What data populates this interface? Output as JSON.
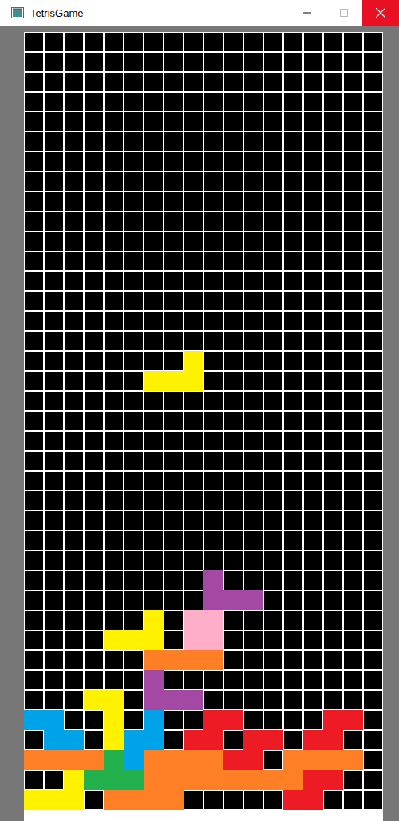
{
  "window": {
    "title": "TetrisGame"
  },
  "board": {
    "columns": 18,
    "rows": 39,
    "blocks": [
      {
        "row": 27,
        "col": 9,
        "color": "#a349a4"
      },
      {
        "row": 28,
        "col": 9,
        "color": "#a349a4"
      },
      {
        "row": 28,
        "col": 10,
        "color": "#a349a4"
      },
      {
        "row": 28,
        "col": 11,
        "color": "#a349a4"
      },
      {
        "row": 29,
        "col": 6,
        "color": "#fff200"
      },
      {
        "row": 29,
        "col": 8,
        "color": "#ffaec9"
      },
      {
        "row": 29,
        "col": 9,
        "color": "#ffaec9"
      },
      {
        "row": 30,
        "col": 4,
        "color": "#fff200"
      },
      {
        "row": 30,
        "col": 5,
        "color": "#fff200"
      },
      {
        "row": 30,
        "col": 6,
        "color": "#fff200"
      },
      {
        "row": 30,
        "col": 8,
        "color": "#ffaec9"
      },
      {
        "row": 30,
        "col": 9,
        "color": "#ffaec9"
      },
      {
        "row": 31,
        "col": 6,
        "color": "#ff7f27"
      },
      {
        "row": 31,
        "col": 7,
        "color": "#ff7f27"
      },
      {
        "row": 31,
        "col": 8,
        "color": "#ff7f27"
      },
      {
        "row": 31,
        "col": 9,
        "color": "#ff7f27"
      },
      {
        "row": 32,
        "col": 6,
        "color": "#a349a4"
      },
      {
        "row": 33,
        "col": 3,
        "color": "#fff200"
      },
      {
        "row": 33,
        "col": 4,
        "color": "#fff200"
      },
      {
        "row": 33,
        "col": 6,
        "color": "#a349a4"
      },
      {
        "row": 33,
        "col": 7,
        "color": "#a349a4"
      },
      {
        "row": 33,
        "col": 8,
        "color": "#a349a4"
      },
      {
        "row": 34,
        "col": 0,
        "color": "#00a2e8"
      },
      {
        "row": 34,
        "col": 1,
        "color": "#00a2e8"
      },
      {
        "row": 34,
        "col": 4,
        "color": "#fff200"
      },
      {
        "row": 34,
        "col": 6,
        "color": "#00a2e8"
      },
      {
        "row": 34,
        "col": 9,
        "color": "#ed1c24"
      },
      {
        "row": 34,
        "col": 10,
        "color": "#ed1c24"
      },
      {
        "row": 34,
        "col": 15,
        "color": "#ed1c24"
      },
      {
        "row": 34,
        "col": 16,
        "color": "#ed1c24"
      },
      {
        "row": 35,
        "col": 1,
        "color": "#00a2e8"
      },
      {
        "row": 35,
        "col": 2,
        "color": "#00a2e8"
      },
      {
        "row": 35,
        "col": 4,
        "color": "#fff200"
      },
      {
        "row": 35,
        "col": 5,
        "color": "#00a2e8"
      },
      {
        "row": 35,
        "col": 6,
        "color": "#00a2e8"
      },
      {
        "row": 35,
        "col": 8,
        "color": "#ed1c24"
      },
      {
        "row": 35,
        "col": 9,
        "color": "#ed1c24"
      },
      {
        "row": 35,
        "col": 11,
        "color": "#ed1c24"
      },
      {
        "row": 35,
        "col": 12,
        "color": "#ed1c24"
      },
      {
        "row": 35,
        "col": 14,
        "color": "#ed1c24"
      },
      {
        "row": 35,
        "col": 15,
        "color": "#ed1c24"
      },
      {
        "row": 36,
        "col": 0,
        "color": "#ff7f27"
      },
      {
        "row": 36,
        "col": 1,
        "color": "#ff7f27"
      },
      {
        "row": 36,
        "col": 2,
        "color": "#ff7f27"
      },
      {
        "row": 36,
        "col": 3,
        "color": "#ff7f27"
      },
      {
        "row": 36,
        "col": 4,
        "color": "#22b14c"
      },
      {
        "row": 36,
        "col": 5,
        "color": "#00a2e8"
      },
      {
        "row": 36,
        "col": 6,
        "color": "#ff7f27"
      },
      {
        "row": 36,
        "col": 7,
        "color": "#ff7f27"
      },
      {
        "row": 36,
        "col": 8,
        "color": "#ff7f27"
      },
      {
        "row": 36,
        "col": 9,
        "color": "#ff7f27"
      },
      {
        "row": 36,
        "col": 10,
        "color": "#ed1c24"
      },
      {
        "row": 36,
        "col": 11,
        "color": "#ed1c24"
      },
      {
        "row": 36,
        "col": 13,
        "color": "#ff7f27"
      },
      {
        "row": 36,
        "col": 14,
        "color": "#ff7f27"
      },
      {
        "row": 36,
        "col": 15,
        "color": "#ff7f27"
      },
      {
        "row": 36,
        "col": 16,
        "color": "#ff7f27"
      },
      {
        "row": 37,
        "col": 2,
        "color": "#fff200"
      },
      {
        "row": 37,
        "col": 3,
        "color": "#22b14c"
      },
      {
        "row": 37,
        "col": 4,
        "color": "#22b14c"
      },
      {
        "row": 37,
        "col": 5,
        "color": "#22b14c"
      },
      {
        "row": 37,
        "col": 6,
        "color": "#ff7f27"
      },
      {
        "row": 37,
        "col": 7,
        "color": "#ff7f27"
      },
      {
        "row": 37,
        "col": 8,
        "color": "#ff7f27"
      },
      {
        "row": 37,
        "col": 9,
        "color": "#ff7f27"
      },
      {
        "row": 37,
        "col": 10,
        "color": "#ff7f27"
      },
      {
        "row": 37,
        "col": 11,
        "color": "#ff7f27"
      },
      {
        "row": 37,
        "col": 12,
        "color": "#ff7f27"
      },
      {
        "row": 37,
        "col": 13,
        "color": "#ff7f27"
      },
      {
        "row": 37,
        "col": 14,
        "color": "#ed1c24"
      },
      {
        "row": 37,
        "col": 15,
        "color": "#ed1c24"
      },
      {
        "row": 38,
        "col": 0,
        "color": "#fff200"
      },
      {
        "row": 38,
        "col": 1,
        "color": "#fff200"
      },
      {
        "row": 38,
        "col": 2,
        "color": "#fff200"
      },
      {
        "row": 38,
        "col": 4,
        "color": "#ff7f27"
      },
      {
        "row": 38,
        "col": 5,
        "color": "#ff7f27"
      },
      {
        "row": 38,
        "col": 6,
        "color": "#ff7f27"
      },
      {
        "row": 38,
        "col": 7,
        "color": "#ff7f27"
      },
      {
        "row": 38,
        "col": 13,
        "color": "#ed1c24"
      },
      {
        "row": 38,
        "col": 14,
        "color": "#ed1c24"
      }
    ]
  },
  "falling_piece": {
    "color": "#fff200",
    "cells": [
      {
        "row": 16,
        "col": 8
      },
      {
        "row": 17,
        "col": 6
      },
      {
        "row": 17,
        "col": 7
      },
      {
        "row": 17,
        "col": 8
      }
    ]
  }
}
